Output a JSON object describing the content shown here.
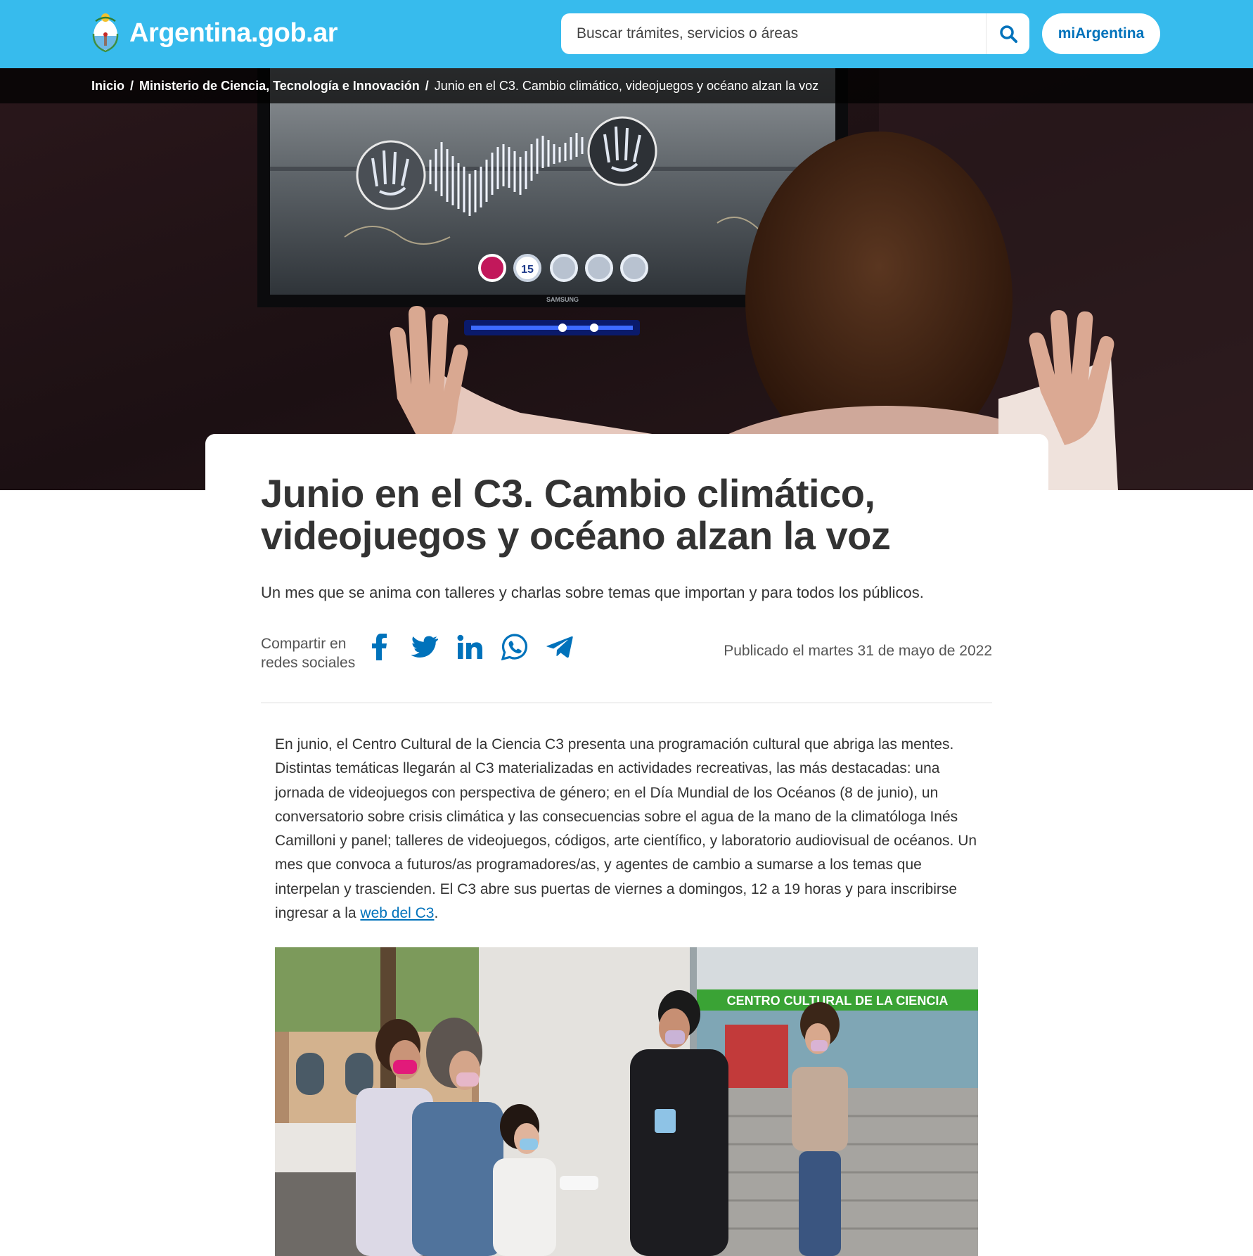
{
  "header": {
    "brand": "Argentina.gob.ar",
    "search_placeholder": "Buscar trámites, servicios o áreas",
    "mi_button": "miArgentina",
    "colors": {
      "topbar": "#37bbed",
      "link": "#0072bb"
    }
  },
  "breadcrumb": {
    "items": [
      "Inicio",
      "Ministerio de Ciencia, Tecnología e Innovación"
    ],
    "current": "Junio en el C3. Cambio climático, videojuegos y océano alzan la voz"
  },
  "hero": {
    "screen_counter": "15",
    "screen_brand": "SAMSUNG"
  },
  "article": {
    "title": "Junio en el C3. Cambio climático, videojuegos y océano alzan la voz",
    "lead": "Un mes que se anima con talleres y charlas sobre temas que importan y para todos los públicos.",
    "share_line1": "Compartir en",
    "share_line2": "redes sociales",
    "socials": [
      "facebook-icon",
      "twitter-icon",
      "linkedin-icon",
      "whatsapp-icon",
      "telegram-icon"
    ],
    "published": "Publicado el martes 31 de mayo de 2022",
    "body": "En junio, el Centro Cultural de la Ciencia C3 presenta una programación cultural que abriga las mentes. Distintas temáticas llegarán al C3 materializadas en actividades recreativas, las más destacadas: una jornada de videojuegos con perspectiva de género; en el Día Mundial de los Océanos (8 de junio), un conversatorio sobre crisis climática y las consecuencias sobre el agua de la mano de la climatóloga Inés Camilloni y panel; talleres de videojuegos, códigos, arte científico, y laboratorio audiovisual de océanos. Un mes que convoca a futuros/as programadores/as, y agentes de cambio a sumarse a los temas que interpelan y trascienden. El C3 abre sus puertas de viernes a domingos, 12 a 19 horas y para inscribirse ingresar a la ",
    "link_text": "web del C3",
    "body_end": ".",
    "photo_sign_1": "CENTRO CULTURAL DE LA CIENCIA",
    "photo_sign_2": "DE LA CIENCIA"
  }
}
